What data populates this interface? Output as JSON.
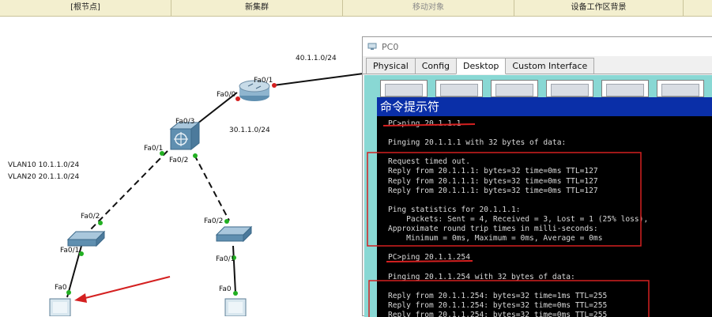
{
  "toolbar": {
    "items": [
      "[根节点]",
      "新集群",
      "移动对象",
      "设备工作区背景"
    ]
  },
  "topology": {
    "labels": {
      "net40": "40.1.1.0/24",
      "net30": "30.1.1.0/24",
      "vlan10": "VLAN10   10.1.1.0/24",
      "vlan20": "VLAN20   20.1.1.0/24",
      "router_fa01": "Fa0/1",
      "router_fa00": "Fa0/0",
      "l3_fa03": "Fa0/3",
      "l3_fa01": "Fa0/1",
      "l3_fa02": "Fa0/2",
      "swl_fa02": "Fa0/2",
      "swl_fa01": "Fa0/1",
      "pcl_fa0": "Fa0",
      "swr_fa02": "Fa0/2",
      "swr_fa01": "Fa0/1",
      "pcr_fa0": "Fa0"
    }
  },
  "pc_window": {
    "title": "PC0",
    "tabs": [
      "Physical",
      "Config",
      "Desktop",
      "Custom Interface"
    ],
    "active_tab": "Desktop",
    "cmd_title": "命令提示符",
    "lines": [
      "PC>ping 20.1.1.1",
      "",
      "Pinging 20.1.1.1 with 32 bytes of data:",
      "",
      "Request timed out.",
      "Reply from 20.1.1.1: bytes=32 time=0ms TTL=127",
      "Reply from 20.1.1.1: bytes=32 time=0ms TTL=127",
      "Reply from 20.1.1.1: bytes=32 time=0ms TTL=127",
      "",
      "Ping statistics for 20.1.1.1:",
      "    Packets: Sent = 4, Received = 3, Lost = 1 (25% loss),",
      "Approximate round trip times in milli-seconds:",
      "    Minimum = 0ms, Maximum = 0ms, Average = 0ms",
      "",
      "PC>ping 20.1.1.254",
      "",
      "Pinging 20.1.1.254 with 32 bytes of data:",
      "",
      "Reply from 20.1.1.254: bytes=32 time=1ms TTL=255",
      "Reply from 20.1.1.254: bytes=32 time=0ms TTL=255",
      "Reply from 20.1.1.254: bytes=32 time=0ms TTL=255"
    ]
  },
  "colors": {
    "annotation_red": "#d42020",
    "link_green": "#22b022",
    "link_red": "#d42020",
    "cmd_title_bg": "#0a2fa8"
  }
}
